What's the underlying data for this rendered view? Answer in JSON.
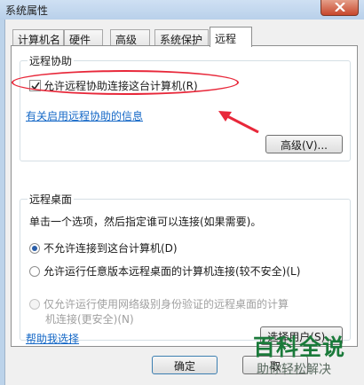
{
  "window": {
    "title": "系统属性"
  },
  "tabs": [
    {
      "label": "计算机名"
    },
    {
      "label": "硬件"
    },
    {
      "label": "高级"
    },
    {
      "label": "系统保护"
    },
    {
      "label": "远程"
    }
  ],
  "remote_assistance": {
    "group_title": "远程协助",
    "allow_label": "允许远程协助连接这台计算机(R)",
    "allow_checked": true,
    "info_link": "有关启用远程协助的信息",
    "advanced_button": "高级(V)..."
  },
  "remote_desktop": {
    "group_title": "远程桌面",
    "instruction": "单击一个选项，然后指定谁可以连接(如果需要)。",
    "options": [
      {
        "label": "不允许连接到这台计算机(D)",
        "checked": true,
        "enabled": true
      },
      {
        "label": "允许运行任意版本远程桌面的计算机连接(较不安全)(L)",
        "checked": false,
        "enabled": true
      },
      {
        "label_line1": "仅允许运行使用网络级别身份验证的远程桌面的计算",
        "label_line2": "机连接(更安全)(N)",
        "checked": false,
        "enabled": false
      }
    ],
    "help_link": "帮助我选择",
    "select_users_button": "选择用户(S)..."
  },
  "footer": {
    "ok_button": "确定",
    "cancel_button": "取"
  },
  "watermark": {
    "title": "百科全说",
    "subtitle": "助你轻松解决"
  },
  "colors": {
    "annotation_red": "#e8283a",
    "link_blue": "#1568c7",
    "watermark_green": "#1a7a3a"
  }
}
